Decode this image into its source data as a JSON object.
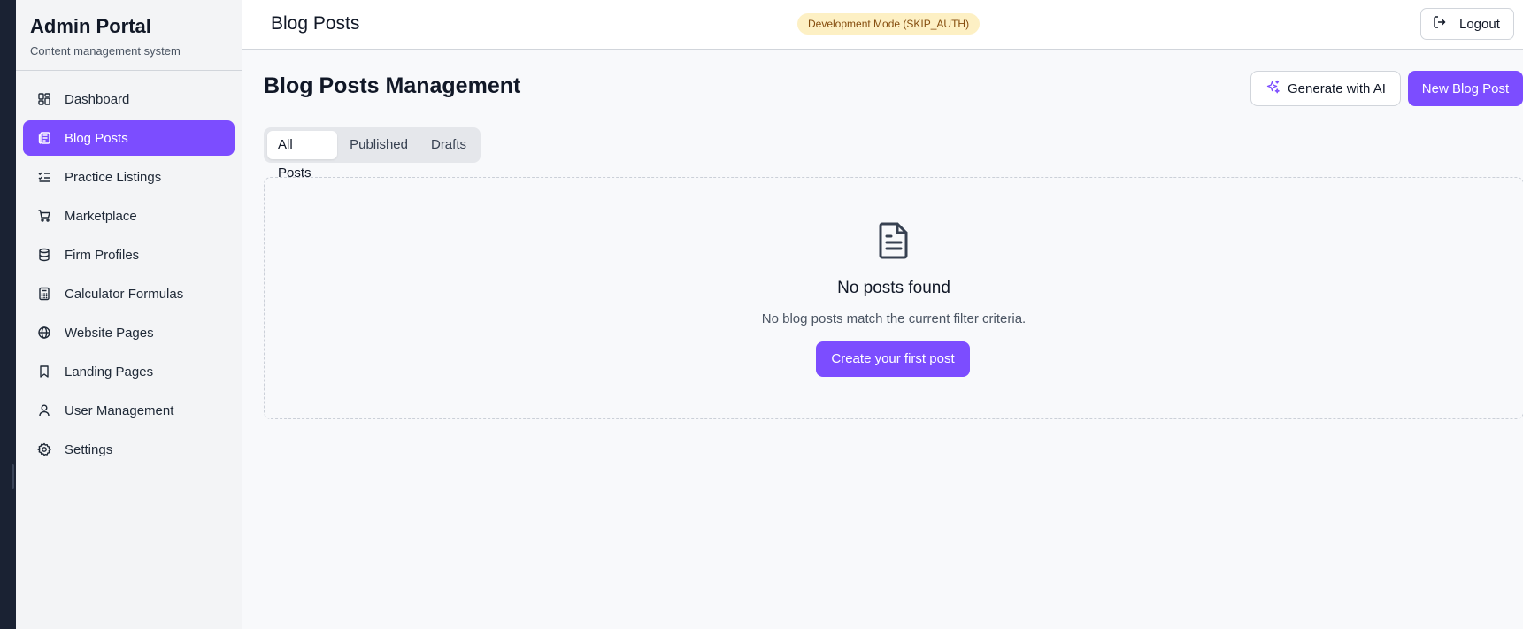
{
  "sidebar": {
    "title": "Admin Portal",
    "subtitle": "Content management system",
    "items": [
      {
        "label": "Dashboard",
        "icon": "dashboard-icon"
      },
      {
        "label": "Blog Posts",
        "icon": "newspaper-icon",
        "active": true
      },
      {
        "label": "Practice Listings",
        "icon": "checklist-icon"
      },
      {
        "label": "Marketplace",
        "icon": "cart-icon"
      },
      {
        "label": "Firm Profiles",
        "icon": "database-icon"
      },
      {
        "label": "Calculator Formulas",
        "icon": "calculator-icon"
      },
      {
        "label": "Website Pages",
        "icon": "globe-icon"
      },
      {
        "label": "Landing Pages",
        "icon": "bookmark-icon"
      },
      {
        "label": "User Management",
        "icon": "user-icon"
      },
      {
        "label": "Settings",
        "icon": "gear-icon"
      }
    ]
  },
  "header": {
    "title": "Blog Posts",
    "badge": "Development Mode (SKIP_AUTH)",
    "logout": "Logout"
  },
  "main": {
    "title": "Blog Posts Management",
    "generate_ai": "Generate with AI",
    "new_post": "New Blog Post",
    "tabs": [
      "All Posts",
      "Published",
      "Drafts"
    ],
    "active_tab": "All Posts",
    "empty": {
      "title": "No posts found",
      "description": "No blog posts match the current filter criteria.",
      "action": "Create your first post"
    }
  },
  "colors": {
    "accent": "#7c4dff",
    "badge_bg": "#fdf0c4",
    "badge_text": "#854d0e",
    "sidebar_bg": "#f3f4f6",
    "main_bg": "#f8f9fb"
  }
}
